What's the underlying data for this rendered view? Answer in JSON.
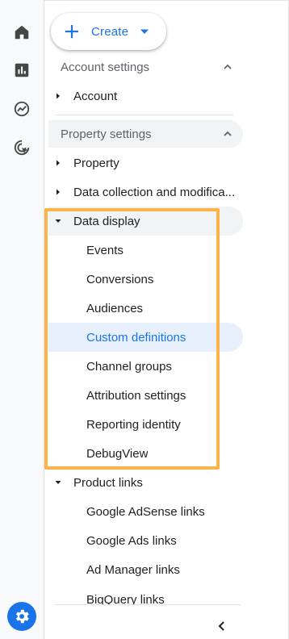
{
  "create_button": {
    "label": "Create"
  },
  "rail": {
    "icons": [
      "home-icon",
      "reports-icon",
      "explore-icon",
      "advertising-icon"
    ],
    "admin_icon": "gear-icon",
    "accent": "#1a73e8"
  },
  "account_settings": {
    "header": "Account settings",
    "items": [
      {
        "label": "Account"
      }
    ]
  },
  "property_settings": {
    "header": "Property settings",
    "items": [
      {
        "label": "Property"
      },
      {
        "label": "Data collection and modifica..."
      }
    ]
  },
  "data_display": {
    "label": "Data display",
    "children": [
      {
        "label": "Events"
      },
      {
        "label": "Conversions"
      },
      {
        "label": "Audiences"
      },
      {
        "label": "Custom definitions",
        "active": true
      },
      {
        "label": "Channel groups"
      },
      {
        "label": "Attribution settings"
      },
      {
        "label": "Reporting identity"
      },
      {
        "label": "DebugView"
      }
    ]
  },
  "product_links": {
    "label": "Product links",
    "children": [
      {
        "label": "Google AdSense links"
      },
      {
        "label": "Google Ads links"
      },
      {
        "label": "Ad Manager links"
      },
      {
        "label": "BigQuery links"
      }
    ]
  },
  "colors": {
    "highlight": "#fbb34b",
    "active_bg": "#e8f0fe",
    "active_text": "#1a73e8"
  }
}
